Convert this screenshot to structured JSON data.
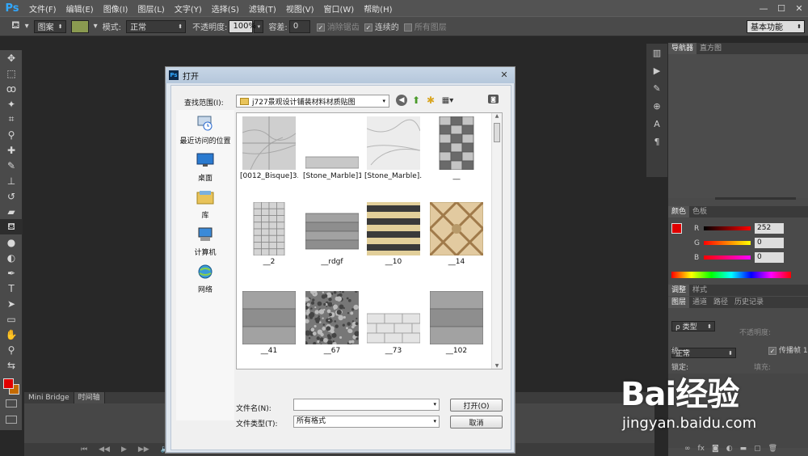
{
  "app": {
    "logo": "Ps"
  },
  "menu": [
    "文件(F)",
    "编辑(E)",
    "图像(I)",
    "图层(L)",
    "文字(Y)",
    "选择(S)",
    "滤镜(T)",
    "视图(V)",
    "窗口(W)",
    "帮助(H)"
  ],
  "window_controls": [
    "—",
    "☐",
    "✕"
  ],
  "options": {
    "fill_type": "图案",
    "mode_label": "模式:",
    "mode_value": "正常",
    "opacity_label": "不透明度:",
    "opacity_value": "100%",
    "tolerance_label": "容差:",
    "tolerance_value": "0",
    "antialias": "消除锯齿",
    "contiguous": "连续的",
    "all_layers": "所有图层",
    "workspace": "基本功能",
    "pattern_color": "#8a9a50"
  },
  "bottom_tabs": [
    "Mini Bridge",
    "时间轴"
  ],
  "right_panel": {
    "nav_tabs": [
      "导航器",
      "直方图"
    ],
    "color_tabs": [
      "颜色",
      "色板"
    ],
    "r_label": "R",
    "r_value": "252",
    "g_label": "G",
    "g_value": "0",
    "b_label": "B",
    "b_value": "0",
    "adj_tabs": [
      "调整",
      "样式"
    ],
    "layer_tabs": [
      "图层",
      "通道",
      "路径",
      "历史记录"
    ],
    "kind_label": "ρ 类型",
    "blend_mode": "正常",
    "opacity_label": "不透明度:",
    "unify_label": "统一:",
    "propagate_label": "传播帧 1",
    "lock_label": "锁定:",
    "fill_label": "填充:"
  },
  "dialog": {
    "title": "打开",
    "look_in_label": "查找范围(I):",
    "look_in_value": "j727景观设计铺装材料材质贴图",
    "places": [
      "最近访问的位置",
      "桌面",
      "库",
      "计算机",
      "网络"
    ],
    "files": [
      {
        "name": "[0012_Bisque]3...",
        "tex": "marble"
      },
      {
        "name": "[Stone_Marble]1",
        "tex": "strip"
      },
      {
        "name": "[Stone_Marble]...",
        "tex": "marble2"
      },
      {
        "name": "__",
        "tex": "tiles"
      },
      {
        "name": "__2",
        "tex": "grid"
      },
      {
        "name": "__rdgf",
        "tex": "planks"
      },
      {
        "name": "__10",
        "tex": "stripes"
      },
      {
        "name": "__14",
        "tex": "diamond"
      },
      {
        "name": "__41",
        "tex": "planks2"
      },
      {
        "name": "__67",
        "tex": "gravel"
      },
      {
        "name": "__73",
        "tex": "bricks"
      },
      {
        "name": "__102",
        "tex": "planks3"
      }
    ],
    "filename_label": "文件名(N):",
    "filename_value": "",
    "filetype_label": "文件类型(T):",
    "filetype_value": "所有格式",
    "open_button": "打开(O)",
    "cancel_button": "取消"
  },
  "watermark": {
    "logo_text": "Bai经验",
    "url": "jingyan.baidu.com"
  }
}
